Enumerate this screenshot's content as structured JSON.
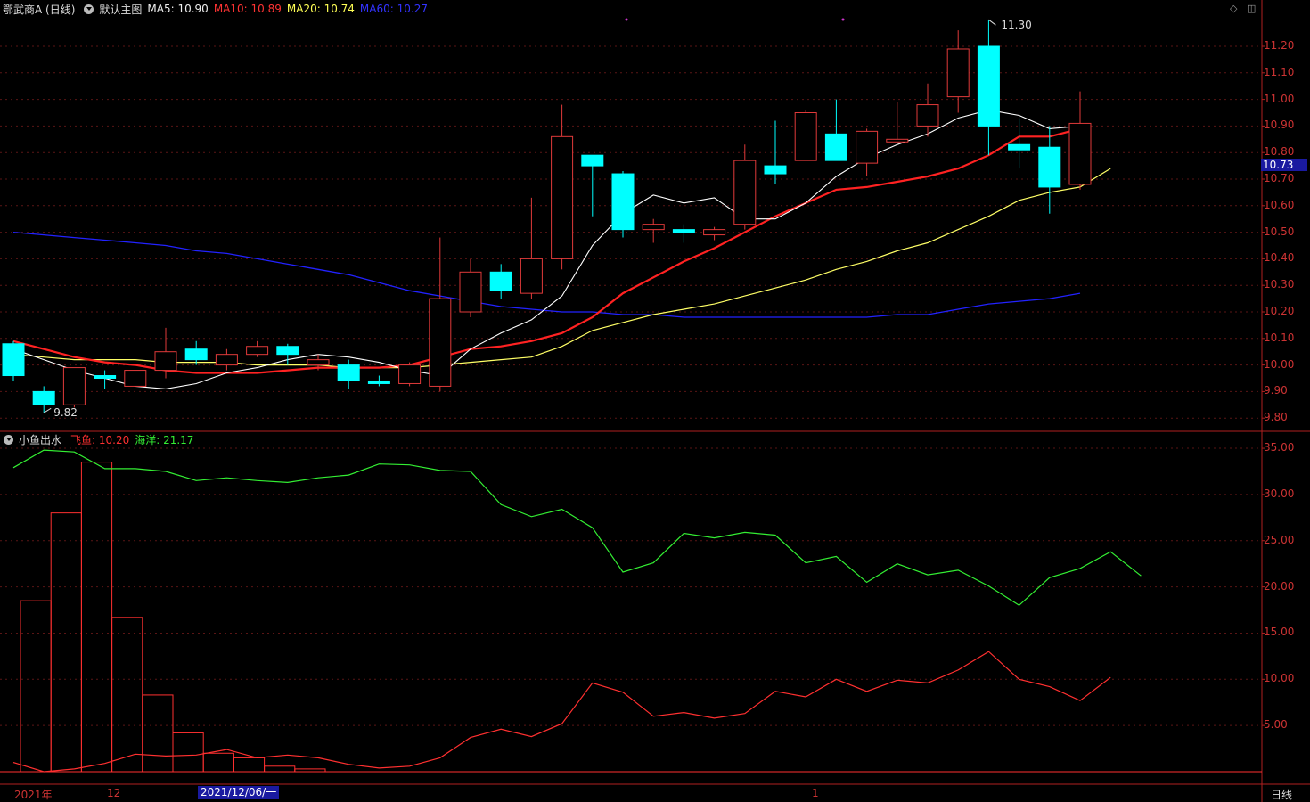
{
  "header": {
    "stock": "鄂武商A (日线)",
    "main_indicator": "默认主图",
    "ma5": "MA5: 10.90",
    "ma10": "MA10: 10.89",
    "ma20": "MA20: 10.74",
    "ma60": "MA60: 10.27"
  },
  "sub_header": {
    "indicator": "小鱼出水",
    "flying_fish": "飞鱼: 10.20",
    "ocean": "海洋: 21.17"
  },
  "price_axis": [
    "11.20",
    "11.10",
    "11.00",
    "10.90",
    "10.80",
    "10.70",
    "10.60",
    "10.50",
    "10.40",
    "10.30",
    "10.20",
    "10.10",
    "10.00",
    "9.90",
    "9.80"
  ],
  "sub_axis": [
    "35.00",
    "30.00",
    "25.00",
    "20.00",
    "15.00",
    "10.00",
    "5.00"
  ],
  "current_price": "10.73",
  "high_label": "11.30",
  "low_label": "9.82",
  "date_labels": {
    "year": "2021年",
    "month": "12",
    "highlight": "2021/12/06/一",
    "next_month": "1"
  },
  "period_label": "日线",
  "colors": {
    "up": "#e03a3a",
    "down": "#00ffff",
    "ma5": "#ffffff",
    "ma10": "#ff2222",
    "ma20": "#ffff66",
    "ma60": "#2222ff",
    "fish": "#ff3030",
    "ocean": "#33ee33"
  },
  "chart_data": [
    {
      "type": "candlestick",
      "price_range": [
        9.75,
        11.3
      ],
      "candles": [
        {
          "o": 10.08,
          "h": 10.09,
          "l": 9.94,
          "c": 9.96
        },
        {
          "o": 9.9,
          "h": 9.92,
          "l": 9.82,
          "c": 9.85
        },
        {
          "o": 9.85,
          "h": 9.99,
          "l": 9.84,
          "c": 9.99
        },
        {
          "o": 9.96,
          "h": 9.98,
          "l": 9.91,
          "c": 9.95
        },
        {
          "o": 9.92,
          "h": 9.98,
          "l": 9.92,
          "c": 9.98
        },
        {
          "o": 9.98,
          "h": 10.14,
          "l": 9.95,
          "c": 10.05
        },
        {
          "o": 10.06,
          "h": 10.09,
          "l": 10.0,
          "c": 10.02
        },
        {
          "o": 10.0,
          "h": 10.06,
          "l": 9.98,
          "c": 10.04
        },
        {
          "o": 10.04,
          "h": 10.09,
          "l": 10.03,
          "c": 10.07
        },
        {
          "o": 10.07,
          "h": 10.08,
          "l": 10.0,
          "c": 10.04
        },
        {
          "o": 10.0,
          "h": 10.04,
          "l": 9.98,
          "c": 10.02
        },
        {
          "o": 10.0,
          "h": 10.02,
          "l": 9.91,
          "c": 9.94
        },
        {
          "o": 9.94,
          "h": 9.96,
          "l": 9.92,
          "c": 9.93
        },
        {
          "o": 9.93,
          "h": 10.01,
          "l": 9.92,
          "c": 10.0
        },
        {
          "o": 9.92,
          "h": 10.48,
          "l": 9.9,
          "c": 10.25
        },
        {
          "o": 10.2,
          "h": 10.4,
          "l": 10.18,
          "c": 10.35
        },
        {
          "o": 10.35,
          "h": 10.38,
          "l": 10.25,
          "c": 10.28
        },
        {
          "o": 10.27,
          "h": 10.63,
          "l": 10.25,
          "c": 10.4
        },
        {
          "o": 10.4,
          "h": 10.98,
          "l": 10.36,
          "c": 10.86
        },
        {
          "o": 10.79,
          "h": 10.79,
          "l": 10.56,
          "c": 10.75
        },
        {
          "o": 10.72,
          "h": 10.73,
          "l": 10.48,
          "c": 10.51
        },
        {
          "o": 10.51,
          "h": 10.55,
          "l": 10.46,
          "c": 10.53
        },
        {
          "o": 10.51,
          "h": 10.53,
          "l": 10.46,
          "c": 10.5
        },
        {
          "o": 10.49,
          "h": 10.52,
          "l": 10.47,
          "c": 10.51
        },
        {
          "o": 10.53,
          "h": 10.83,
          "l": 10.51,
          "c": 10.77
        },
        {
          "o": 10.75,
          "h": 10.92,
          "l": 10.68,
          "c": 10.72
        },
        {
          "o": 10.77,
          "h": 10.96,
          "l": 10.77,
          "c": 10.95
        },
        {
          "o": 10.87,
          "h": 11.0,
          "l": 10.77,
          "c": 10.77
        },
        {
          "o": 10.76,
          "h": 10.89,
          "l": 10.71,
          "c": 10.88
        },
        {
          "o": 10.84,
          "h": 10.99,
          "l": 10.84,
          "c": 10.85
        },
        {
          "o": 10.9,
          "h": 11.06,
          "l": 10.86,
          "c": 10.98
        },
        {
          "o": 11.01,
          "h": 11.26,
          "l": 10.95,
          "c": 11.19
        },
        {
          "o": 11.2,
          "h": 11.3,
          "l": 10.79,
          "c": 10.9
        },
        {
          "o": 10.83,
          "h": 10.93,
          "l": 10.74,
          "c": 10.81
        },
        {
          "o": 10.82,
          "h": 10.9,
          "l": 10.57,
          "c": 10.67
        },
        {
          "o": 10.68,
          "h": 11.03,
          "l": 10.66,
          "c": 10.91
        }
      ],
      "ma5": [
        10.06,
        10.02,
        9.98,
        9.95,
        9.92,
        9.91,
        9.93,
        9.97,
        9.99,
        10.02,
        10.04,
        10.03,
        10.01,
        9.98,
        9.96,
        10.06,
        10.12,
        10.17,
        10.26,
        10.45,
        10.57,
        10.64,
        10.61,
        10.63,
        10.55,
        10.55,
        10.61,
        10.71,
        10.78,
        10.83,
        10.87,
        10.93,
        10.96,
        10.94,
        10.89,
        10.9
      ],
      "ma10": [
        10.09,
        10.06,
        10.03,
        10.01,
        10.0,
        9.98,
        9.97,
        9.97,
        9.97,
        9.98,
        9.99,
        9.99,
        9.99,
        10.0,
        10.03,
        10.06,
        10.07,
        10.09,
        10.12,
        10.18,
        10.27,
        10.33,
        10.39,
        10.44,
        10.5,
        10.56,
        10.61,
        10.66,
        10.67,
        10.69,
        10.71,
        10.74,
        10.79,
        10.86,
        10.86,
        10.89
      ],
      "ma20": [
        10.04,
        10.03,
        10.02,
        10.02,
        10.02,
        10.01,
        10.01,
        10.01,
        10.0,
        10.0,
        10.0,
        9.99,
        9.99,
        9.99,
        10.0,
        10.01,
        10.02,
        10.03,
        10.07,
        10.13,
        10.16,
        10.19,
        10.21,
        10.23,
        10.26,
        10.29,
        10.32,
        10.36,
        10.39,
        10.43,
        10.46,
        10.51,
        10.56,
        10.62,
        10.65,
        10.67,
        10.74
      ],
      "ma60": [
        10.5,
        10.49,
        10.48,
        10.47,
        10.46,
        10.45,
        10.43,
        10.42,
        10.4,
        10.38,
        10.36,
        10.34,
        10.31,
        10.28,
        10.26,
        10.24,
        10.22,
        10.21,
        10.2,
        10.2,
        10.19,
        10.19,
        10.18,
        10.18,
        10.18,
        10.18,
        10.18,
        10.18,
        10.18,
        10.19,
        10.19,
        10.21,
        10.23,
        10.24,
        10.25,
        10.27
      ]
    },
    {
      "type": "line_bar",
      "ylim": [
        0,
        35
      ],
      "fish": [
        1.0,
        0.0,
        0.3,
        0.9,
        1.9,
        1.7,
        1.8,
        2.4,
        1.5,
        1.8,
        1.5,
        0.8,
        0.4,
        0.6,
        1.5,
        3.7,
        4.6,
        3.8,
        5.2,
        9.6,
        8.6,
        6.0,
        6.4,
        5.8,
        6.3,
        8.7,
        8.1,
        10.0,
        8.7,
        9.9,
        9.6,
        11.0,
        13.0,
        10.0,
        9.2,
        7.7,
        10.2
      ],
      "ocean": [
        32.9,
        34.8,
        34.6,
        32.8,
        32.8,
        32.5,
        31.5,
        31.8,
        31.5,
        31.3,
        31.8,
        32.1,
        33.3,
        33.2,
        32.6,
        32.5,
        28.9,
        27.6,
        28.4,
        26.4,
        21.6,
        22.6,
        25.8,
        25.3,
        25.9,
        25.6,
        22.6,
        23.3,
        20.5,
        22.5,
        21.3,
        21.8,
        20.1,
        18.0,
        21.0,
        22.0,
        23.8,
        21.2
      ],
      "bars": [
        18.5,
        28.0,
        33.5,
        16.7,
        8.3,
        4.2,
        2.0,
        1.5,
        0.6,
        0.3
      ]
    }
  ]
}
